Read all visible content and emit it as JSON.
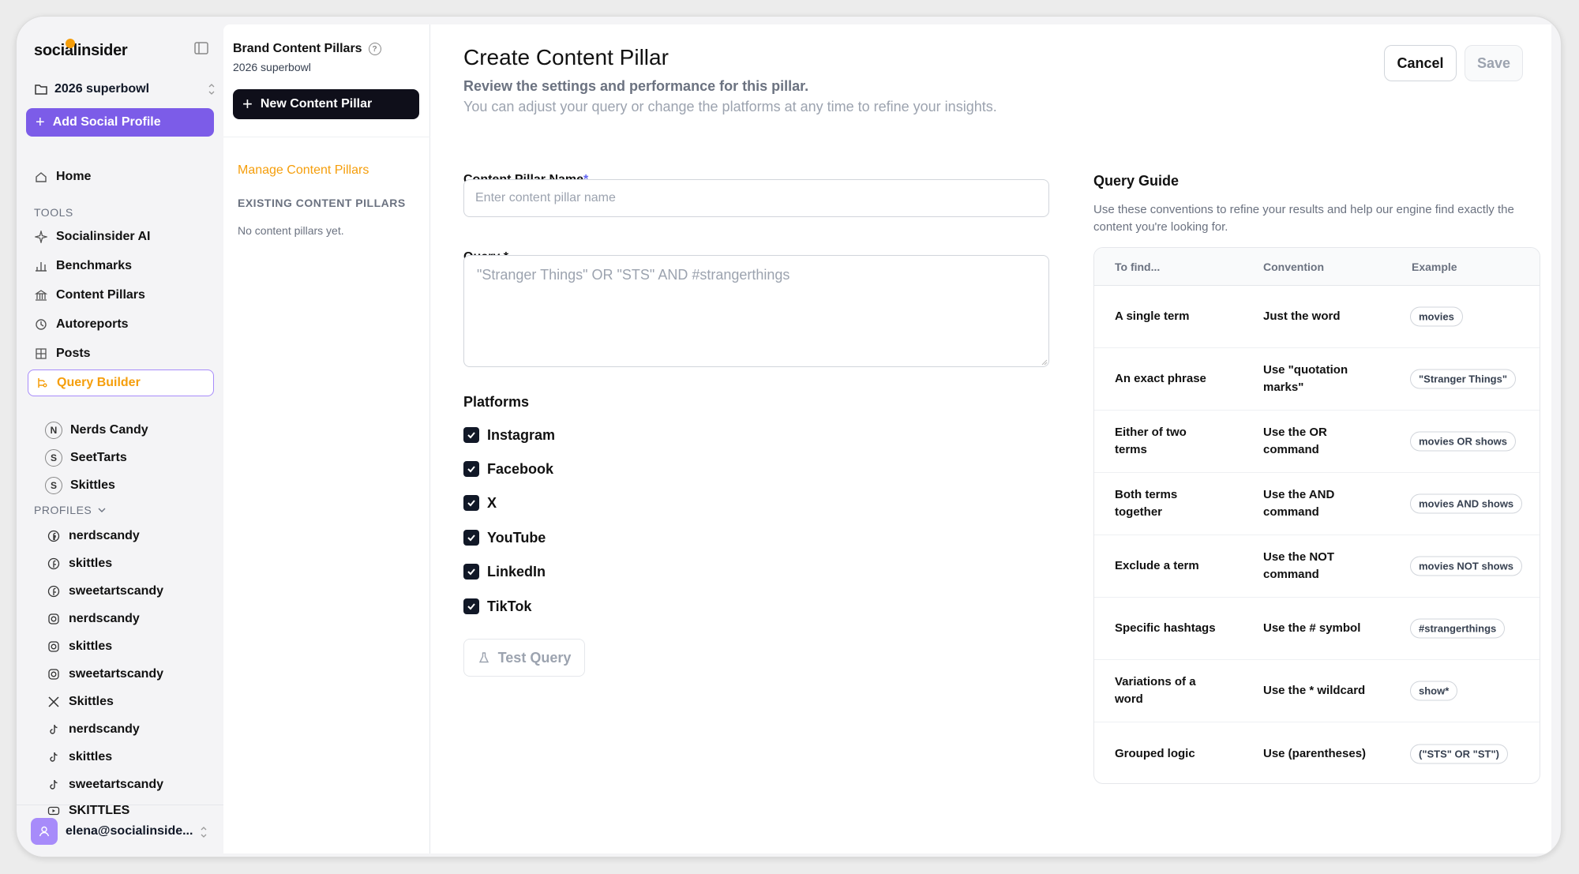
{
  "sidebar": {
    "logo": "socialinsider",
    "workspace": "2026 superbowl",
    "add_profile": "Add Social Profile",
    "home": "Home",
    "tools_label": "TOOLS",
    "tools": [
      {
        "label": "Socialinsider AI",
        "icon": "sparkle-icon"
      },
      {
        "label": "Benchmarks",
        "icon": "bar-chart-icon"
      },
      {
        "label": "Content Pillars",
        "icon": "pillars-icon"
      },
      {
        "label": "Autoreports",
        "icon": "autoreport-icon"
      },
      {
        "label": "Posts",
        "icon": "grid-icon"
      },
      {
        "label": "Query Builder",
        "icon": "query-builder-icon"
      }
    ],
    "brands": [
      {
        "initial": "N",
        "label": "Nerds Candy"
      },
      {
        "initial": "S",
        "label": "SeetTarts"
      },
      {
        "initial": "S",
        "label": "Skittles"
      }
    ],
    "profiles_label": "PROFILES",
    "profiles": [
      {
        "label": "nerdscandy",
        "icon": "facebook-icon"
      },
      {
        "label": "skittles",
        "icon": "facebook-icon"
      },
      {
        "label": "sweetartscandy",
        "icon": "facebook-icon"
      },
      {
        "label": "nerdscandy",
        "icon": "instagram-icon"
      },
      {
        "label": "skittles",
        "icon": "instagram-icon"
      },
      {
        "label": "sweetartscandy",
        "icon": "instagram-icon"
      },
      {
        "label": "Skittles",
        "icon": "x-icon"
      },
      {
        "label": "nerdscandy",
        "icon": "tiktok-icon"
      },
      {
        "label": "skittles",
        "icon": "tiktok-icon"
      },
      {
        "label": "sweetartscandy",
        "icon": "tiktok-icon"
      },
      {
        "label": "SKITTLES",
        "icon": "youtube-icon"
      }
    ],
    "user_email": "elena@socialinside..."
  },
  "middle": {
    "title": "Brand Content Pillars",
    "subtitle": "2026 superbowl",
    "new_button": "New Content Pillar",
    "manage": "Manage Content Pillars",
    "existing_label": "EXISTING CONTENT PILLARS",
    "empty": "No content pillars yet."
  },
  "main": {
    "title": "Create Content Pillar",
    "subtitle": "Review the settings and performance for this pillar.",
    "subtitle2": "You can adjust your query or change the platforms at any time to refine your insights.",
    "cancel": "Cancel",
    "save": "Save",
    "name_label": "Content Pillar Name",
    "name_placeholder": "Enter content pillar name",
    "query_label": "Query *",
    "query_placeholder": "\"Stranger Things\" OR \"STS\" AND #strangerthings",
    "platforms_label": "Platforms",
    "platforms": [
      "Instagram",
      "Facebook",
      "X",
      "YouTube",
      "LinkedIn",
      "TikTok"
    ],
    "test_query": "Test Query"
  },
  "guide": {
    "title": "Query Guide",
    "description": "Use these conventions to refine your results and help our engine find exactly the content you're looking for.",
    "headers": [
      "To find...",
      "Convention",
      "Example"
    ],
    "rows": [
      [
        "A single term",
        "Just the word",
        "movies"
      ],
      [
        "An exact phrase",
        "Use \"quotation marks\"",
        "\"Stranger Things\""
      ],
      [
        "Either of two terms",
        "Use the OR command",
        "movies OR shows"
      ],
      [
        "Both terms together",
        "Use the AND command",
        "movies AND shows"
      ],
      [
        "Exclude a term",
        "Use the NOT command",
        "movies NOT shows"
      ],
      [
        "Specific hashtags",
        "Use the # symbol",
        "#strangerthings"
      ],
      [
        "Variations of a word",
        "Use the * wildcard",
        "show*"
      ],
      [
        "Grouped logic",
        "Use (parentheses)",
        "(\"STS\" OR \"ST\")"
      ]
    ]
  },
  "colors": {
    "accent": "#7c5ce8",
    "highlight": "#f59e0b",
    "dark_button": "#0f0f1a"
  }
}
